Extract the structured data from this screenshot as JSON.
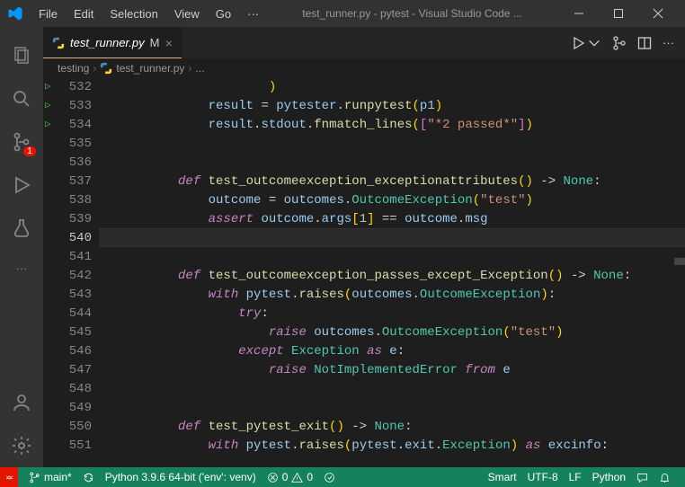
{
  "title": "test_runner.py - pytest - Visual Studio Code ...",
  "menus": [
    "File",
    "Edit",
    "Selection",
    "View",
    "Go",
    "···"
  ],
  "activity_badge": "1",
  "tab": {
    "name": "test_runner.py",
    "modified": "M"
  },
  "breadcrumb": {
    "folder": "testing",
    "file": "test_runner.py",
    "more": "..."
  },
  "lines": [
    {
      "n": "532",
      "run": "",
      "ind": 10,
      "tokens": [
        {
          "c": "punc",
          "t": ")"
        }
      ]
    },
    {
      "n": "533",
      "run": "",
      "ind": 6,
      "tokens": [
        {
          "c": "var",
          "t": "result"
        },
        {
          "c": "op",
          "t": " = "
        },
        {
          "c": "var",
          "t": "pytester"
        },
        {
          "c": "op",
          "t": "."
        },
        {
          "c": "fn",
          "t": "runpytest"
        },
        {
          "c": "punc",
          "t": "("
        },
        {
          "c": "var",
          "t": "p1"
        },
        {
          "c": "punc",
          "t": ")"
        }
      ]
    },
    {
      "n": "534",
      "run": "",
      "ind": 6,
      "tokens": [
        {
          "c": "var",
          "t": "result"
        },
        {
          "c": "op",
          "t": "."
        },
        {
          "c": "var",
          "t": "stdout"
        },
        {
          "c": "op",
          "t": "."
        },
        {
          "c": "fn",
          "t": "fnmatch_lines"
        },
        {
          "c": "punc",
          "t": "("
        },
        {
          "c": "punc2",
          "t": "["
        },
        {
          "c": "str",
          "t": "\"*2 passed*\""
        },
        {
          "c": "punc2",
          "t": "]"
        },
        {
          "c": "punc",
          "t": ")"
        }
      ]
    },
    {
      "n": "535",
      "run": "",
      "ind": 0,
      "tokens": []
    },
    {
      "n": "536",
      "run": "",
      "ind": 0,
      "tokens": []
    },
    {
      "n": "537",
      "run": "▷",
      "ind": 4,
      "tokens": [
        {
          "c": "kw",
          "t": "def "
        },
        {
          "c": "fn",
          "t": "test_outcomeexception_exceptionattributes"
        },
        {
          "c": "punc",
          "t": "()"
        },
        {
          "c": "op",
          "t": " -> "
        },
        {
          "c": "type",
          "t": "None"
        },
        {
          "c": "op",
          "t": ":"
        }
      ]
    },
    {
      "n": "538",
      "run": "",
      "ind": 6,
      "tokens": [
        {
          "c": "var",
          "t": "outcome"
        },
        {
          "c": "op",
          "t": " = "
        },
        {
          "c": "var",
          "t": "outcomes"
        },
        {
          "c": "op",
          "t": "."
        },
        {
          "c": "cls",
          "t": "OutcomeException"
        },
        {
          "c": "punc",
          "t": "("
        },
        {
          "c": "str",
          "t": "\"test\""
        },
        {
          "c": "punc",
          "t": ")"
        }
      ]
    },
    {
      "n": "539",
      "run": "",
      "ind": 6,
      "tokens": [
        {
          "c": "kw",
          "t": "assert "
        },
        {
          "c": "var",
          "t": "outcome"
        },
        {
          "c": "op",
          "t": "."
        },
        {
          "c": "var",
          "t": "args"
        },
        {
          "c": "punc",
          "t": "["
        },
        {
          "c": "num",
          "t": "1"
        },
        {
          "c": "punc",
          "t": "]"
        },
        {
          "c": "op",
          "t": " == "
        },
        {
          "c": "var",
          "t": "outcome"
        },
        {
          "c": "op",
          "t": "."
        },
        {
          "c": "var",
          "t": "msg"
        }
      ]
    },
    {
      "n": "540",
      "run": "",
      "cur": true,
      "ind": 0,
      "tokens": []
    },
    {
      "n": "541",
      "run": "",
      "ind": 0,
      "tokens": []
    },
    {
      "n": "542",
      "run": "▷",
      "ind": 4,
      "tokens": [
        {
          "c": "kw",
          "t": "def "
        },
        {
          "c": "fn",
          "t": "test_outcomeexception_passes_except_Exception"
        },
        {
          "c": "punc",
          "t": "()"
        },
        {
          "c": "op",
          "t": " -> "
        },
        {
          "c": "type",
          "t": "None"
        },
        {
          "c": "op",
          "t": ":"
        }
      ]
    },
    {
      "n": "543",
      "run": "",
      "ind": 6,
      "tokens": [
        {
          "c": "kw",
          "t": "with "
        },
        {
          "c": "var",
          "t": "pytest"
        },
        {
          "c": "op",
          "t": "."
        },
        {
          "c": "fn",
          "t": "raises"
        },
        {
          "c": "punc",
          "t": "("
        },
        {
          "c": "var",
          "t": "outcomes"
        },
        {
          "c": "op",
          "t": "."
        },
        {
          "c": "cls",
          "t": "OutcomeException"
        },
        {
          "c": "punc",
          "t": ")"
        },
        {
          "c": "op",
          "t": ":"
        }
      ]
    },
    {
      "n": "544",
      "run": "",
      "ind": 8,
      "tokens": [
        {
          "c": "kw",
          "t": "try"
        },
        {
          "c": "op",
          "t": ":"
        }
      ]
    },
    {
      "n": "545",
      "run": "",
      "ind": 10,
      "tokens": [
        {
          "c": "kw",
          "t": "raise "
        },
        {
          "c": "var",
          "t": "outcomes"
        },
        {
          "c": "op",
          "t": "."
        },
        {
          "c": "cls",
          "t": "OutcomeException"
        },
        {
          "c": "punc",
          "t": "("
        },
        {
          "c": "str",
          "t": "\"test\""
        },
        {
          "c": "punc",
          "t": ")"
        }
      ]
    },
    {
      "n": "546",
      "run": "",
      "ind": 8,
      "tokens": [
        {
          "c": "kw",
          "t": "except "
        },
        {
          "c": "cls",
          "t": "Exception"
        },
        {
          "c": "kw",
          "t": " as "
        },
        {
          "c": "var",
          "t": "e"
        },
        {
          "c": "op",
          "t": ":"
        }
      ]
    },
    {
      "n": "547",
      "run": "",
      "ind": 10,
      "tokens": [
        {
          "c": "kw",
          "t": "raise "
        },
        {
          "c": "cls",
          "t": "NotImplementedError"
        },
        {
          "c": "kw",
          "t": " from "
        },
        {
          "c": "var",
          "t": "e"
        }
      ]
    },
    {
      "n": "548",
      "run": "",
      "ind": 0,
      "tokens": []
    },
    {
      "n": "549",
      "run": "",
      "ind": 0,
      "tokens": []
    },
    {
      "n": "550",
      "run": "▷",
      "ind": 4,
      "tokens": [
        {
          "c": "kw",
          "t": "def "
        },
        {
          "c": "fn",
          "t": "test_pytest_exit"
        },
        {
          "c": "punc",
          "t": "()"
        },
        {
          "c": "op",
          "t": " -> "
        },
        {
          "c": "type",
          "t": "None"
        },
        {
          "c": "op",
          "t": ":"
        }
      ]
    },
    {
      "n": "551",
      "run": "",
      "ind": 6,
      "tokens": [
        {
          "c": "kw",
          "t": "with "
        },
        {
          "c": "var",
          "t": "pytest"
        },
        {
          "c": "op",
          "t": "."
        },
        {
          "c": "fn",
          "t": "raises"
        },
        {
          "c": "punc",
          "t": "("
        },
        {
          "c": "var",
          "t": "pytest"
        },
        {
          "c": "op",
          "t": "."
        },
        {
          "c": "var",
          "t": "exit"
        },
        {
          "c": "op",
          "t": "."
        },
        {
          "c": "cls",
          "t": "Exception"
        },
        {
          "c": "punc",
          "t": ")"
        },
        {
          "c": "kw",
          "t": " as "
        },
        {
          "c": "var",
          "t": "excinfo"
        },
        {
          "c": "op",
          "t": ":"
        }
      ]
    }
  ],
  "status": {
    "branch": "main*",
    "interpreter": "Python 3.9.6 64-bit ('env': venv)",
    "errors": "0",
    "warnings": "0",
    "spaces": "Smart",
    "encoding": "UTF-8",
    "eol": "LF",
    "lang": "Python"
  }
}
